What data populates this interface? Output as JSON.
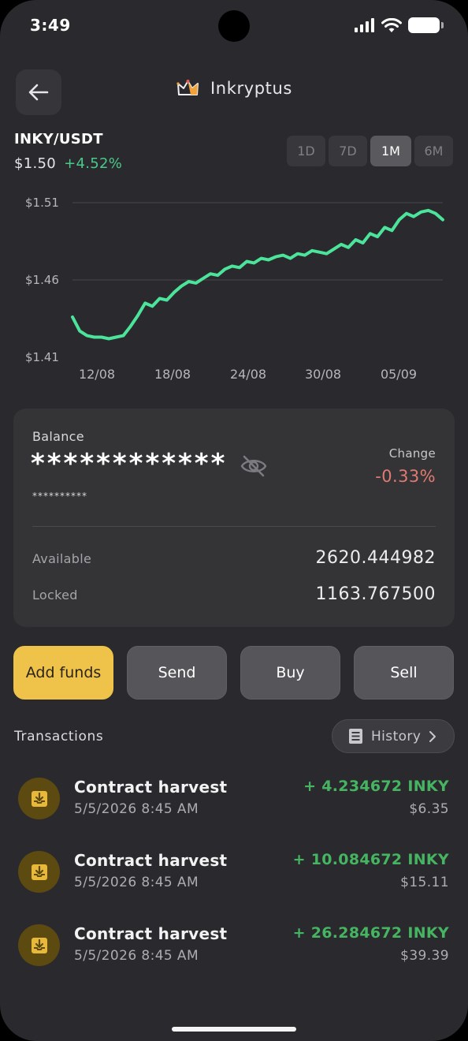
{
  "status_bar": {
    "time": "3:49"
  },
  "header": {
    "title": "Inkryptus",
    "logo_icon": "crown-logo-icon"
  },
  "market": {
    "pair": "INKY/USDT",
    "price": "$1.50",
    "change": "+4.52%",
    "ranges": [
      "1D",
      "7D",
      "1M",
      "6M"
    ],
    "active_range": "1M"
  },
  "chart_data": {
    "type": "line",
    "line_color": "#4ce39a",
    "y_ticks": [
      "$1.51",
      "$1.46",
      "$1.41"
    ],
    "x_ticks": [
      "12/08",
      "18/08",
      "24/08",
      "30/08",
      "05/09"
    ],
    "ylim": [
      1.41,
      1.51
    ],
    "grid": true,
    "series": [
      {
        "values": [
          1.436,
          1.427,
          1.424,
          1.423,
          1.423,
          1.422,
          1.423,
          1.424,
          1.43,
          1.437,
          1.445,
          1.443,
          1.448,
          1.447,
          1.452,
          1.456,
          1.459,
          1.458,
          1.461,
          1.464,
          1.463,
          1.467,
          1.469,
          1.468,
          1.472,
          1.471,
          1.474,
          1.473,
          1.475,
          1.476,
          1.474,
          1.477,
          1.476,
          1.479,
          1.478,
          1.477,
          1.48,
          1.483,
          1.481,
          1.486,
          1.484,
          1.49,
          1.488,
          1.494,
          1.492,
          1.499,
          1.503,
          1.501,
          1.504,
          1.505,
          1.503,
          1.499
        ]
      }
    ]
  },
  "balance": {
    "label": "Balance",
    "masked": "************",
    "sub_masked": "**********",
    "change_label": "Change",
    "change_value": "-0.33%",
    "available_label": "Available",
    "available_value": "2620.444982",
    "locked_label": "Locked",
    "locked_value": "1163.767500"
  },
  "actions": {
    "add_funds": "Add funds",
    "send": "Send",
    "buy": "Buy",
    "sell": "Sell"
  },
  "transactions": {
    "title": "Transactions",
    "history_label": "History",
    "items": [
      {
        "name": "Contract harvest",
        "date": "5/5/2026 8:45 AM",
        "amount": "+ 4.234672 INKY",
        "usd": "$6.35"
      },
      {
        "name": "Contract harvest",
        "date": "5/5/2026 8:45 AM",
        "amount": "+ 10.084672 INKY",
        "usd": "$15.11"
      },
      {
        "name": "Contract harvest",
        "date": "5/5/2026 8:45 AM",
        "amount": "+ 26.284672 INKY",
        "usd": "$39.39"
      }
    ]
  },
  "colors": {
    "accent": "#efc34a",
    "positive": "#4ac98a",
    "negative": "#e07a72",
    "background": "#2a2a2e"
  }
}
